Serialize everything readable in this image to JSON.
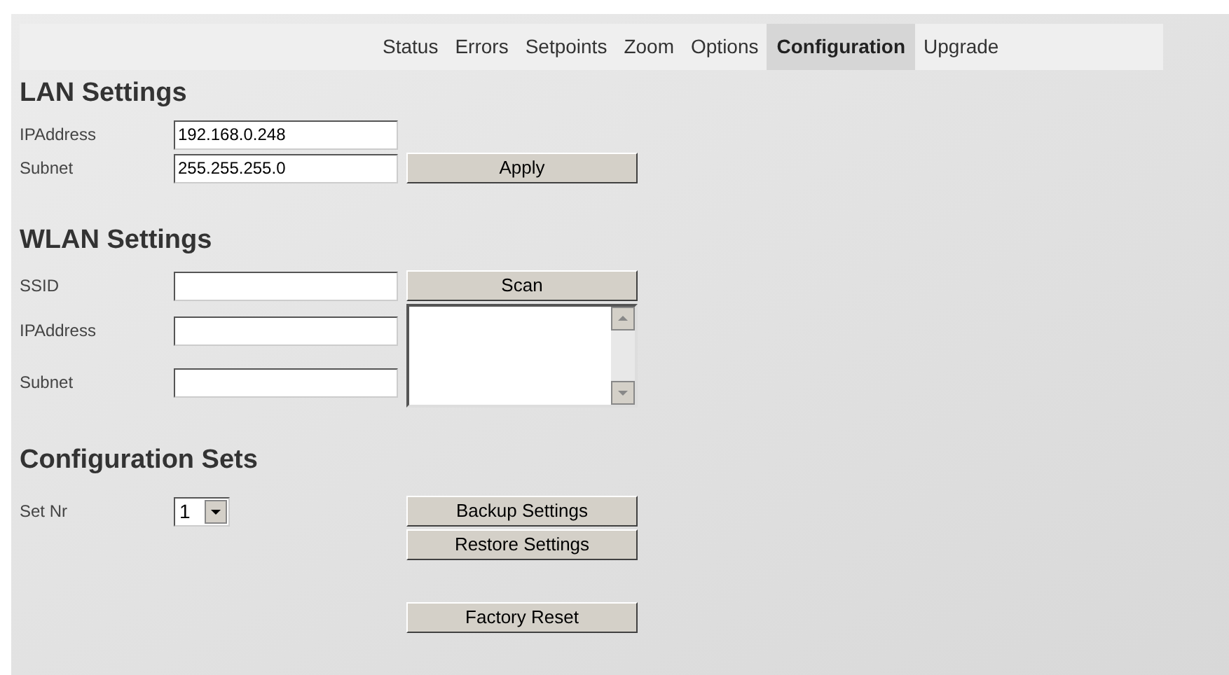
{
  "nav": {
    "tabs": [
      {
        "label": "Status",
        "selected": false
      },
      {
        "label": "Errors",
        "selected": false
      },
      {
        "label": "Setpoints",
        "selected": false
      },
      {
        "label": "Zoom",
        "selected": false
      },
      {
        "label": "Options",
        "selected": false
      },
      {
        "label": "Configuration",
        "selected": true
      },
      {
        "label": "Upgrade",
        "selected": false
      }
    ]
  },
  "lan": {
    "heading": "LAN Settings",
    "ip_label": "IPAddress",
    "ip_value": "192.168.0.248",
    "subnet_label": "Subnet",
    "subnet_value": "255.255.255.0",
    "apply_button": "Apply"
  },
  "wlan": {
    "heading": "WLAN Settings",
    "ssid_label": "SSID",
    "ip_label": "IPAddress",
    "subnet_label": "Subnet",
    "scan_button": "Scan"
  },
  "config_sets": {
    "heading": "Configuration Sets",
    "set_label": "Set Nr",
    "set_value": "1",
    "backup_button": "Backup Settings",
    "restore_button": "Restore Settings",
    "reset_button": "Factory Reset"
  }
}
